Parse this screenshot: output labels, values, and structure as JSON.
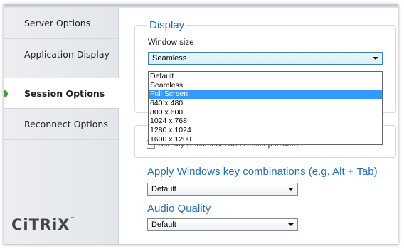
{
  "sidebar": {
    "items": [
      {
        "label": "Server Options"
      },
      {
        "label": "Application Display"
      },
      {
        "label": "Session Options"
      },
      {
        "label": "Reconnect Options"
      }
    ],
    "active_index": 2,
    "logo_text": "CiTRiX",
    "logo_mark": "™"
  },
  "display": {
    "title": "Display",
    "window_size_label": "Window size",
    "window_size_value": "Seamless",
    "options": [
      "Default",
      "Seamless",
      "Full Screen",
      "640 x 480",
      "800 x 600",
      "1024 x 768",
      "1280 x 1024",
      "1600 x 1200"
    ],
    "highlighted_option": "Full Screen"
  },
  "documents": {
    "checkbox_label": "Use My Documents and Desktop folders"
  },
  "windows_keys": {
    "title": "Apply Windows key combinations (e.g. Alt + Tab)",
    "value": "Default"
  },
  "audio": {
    "title": "Audio Quality",
    "value": "Default"
  },
  "colors": {
    "accent": "#1f6fb3",
    "active_indicator": "#3fa231",
    "selection": "#3399ff"
  }
}
